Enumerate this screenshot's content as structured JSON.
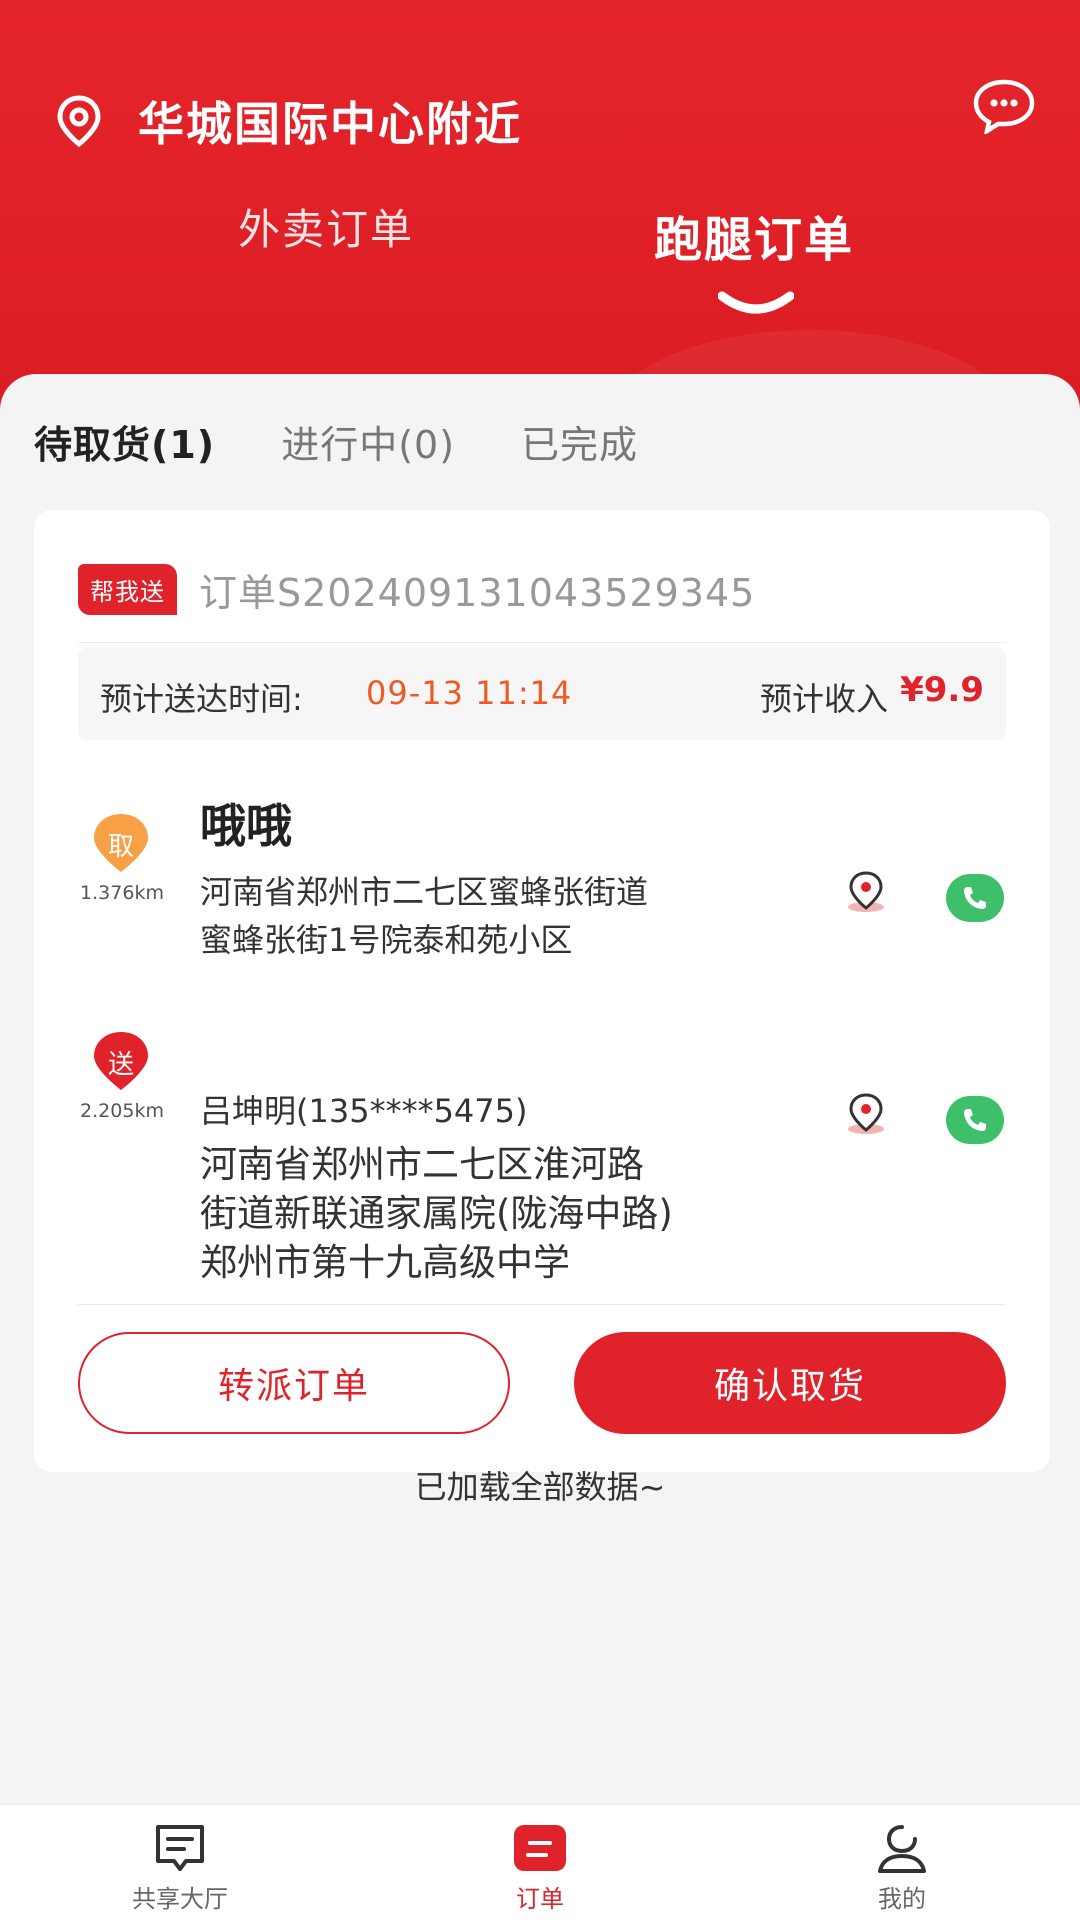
{
  "header": {
    "location": "华城国际中心附近",
    "tabs": [
      {
        "label": "外卖订单",
        "active": false
      },
      {
        "label": "跑腿订单",
        "active": true
      }
    ]
  },
  "sub_tabs": [
    {
      "label": "待取货(1)",
      "active": true
    },
    {
      "label": "进行中(0)",
      "active": false
    },
    {
      "label": "已完成",
      "active": false
    }
  ],
  "order": {
    "badge": "帮我送",
    "order_no": "订单S20240913104352934 5",
    "eta_label": "预计送达时间:",
    "eta_time": "09-13 11:14",
    "income_label": "预计收入",
    "income_value": "¥9.9",
    "pickup": {
      "mark": "取",
      "distance": "1.376km",
      "name": "哦哦",
      "address_line1": "河南省郑州市二七区蜜蜂张街道",
      "address_line2": "蜜蜂张街1号院泰和苑小区"
    },
    "deliver": {
      "mark": "送",
      "distance": "2.205km",
      "receiver": "吕坤明(135****5475)",
      "address_line1": "河南省郑州市二七区淮河路",
      "address_line2": "街道新联通家属院(陇海中路)",
      "address_line3": "郑州市第十九高级中学"
    },
    "btn_transfer": "转派订单",
    "btn_confirm": "确认取货"
  },
  "footer_text": "已加载全部数据~",
  "tabbar": [
    {
      "label": "共享大厅",
      "icon": "hall-icon",
      "active": false
    },
    {
      "label": "订单",
      "icon": "order-icon",
      "active": true
    },
    {
      "label": "我的",
      "icon": "profile-icon",
      "active": false
    }
  ],
  "colors": {
    "brand_red": "#e0232a",
    "eta_orange": "#ee5a24",
    "pickup_orange": "#f7a046",
    "call_green": "#3ec06a"
  }
}
